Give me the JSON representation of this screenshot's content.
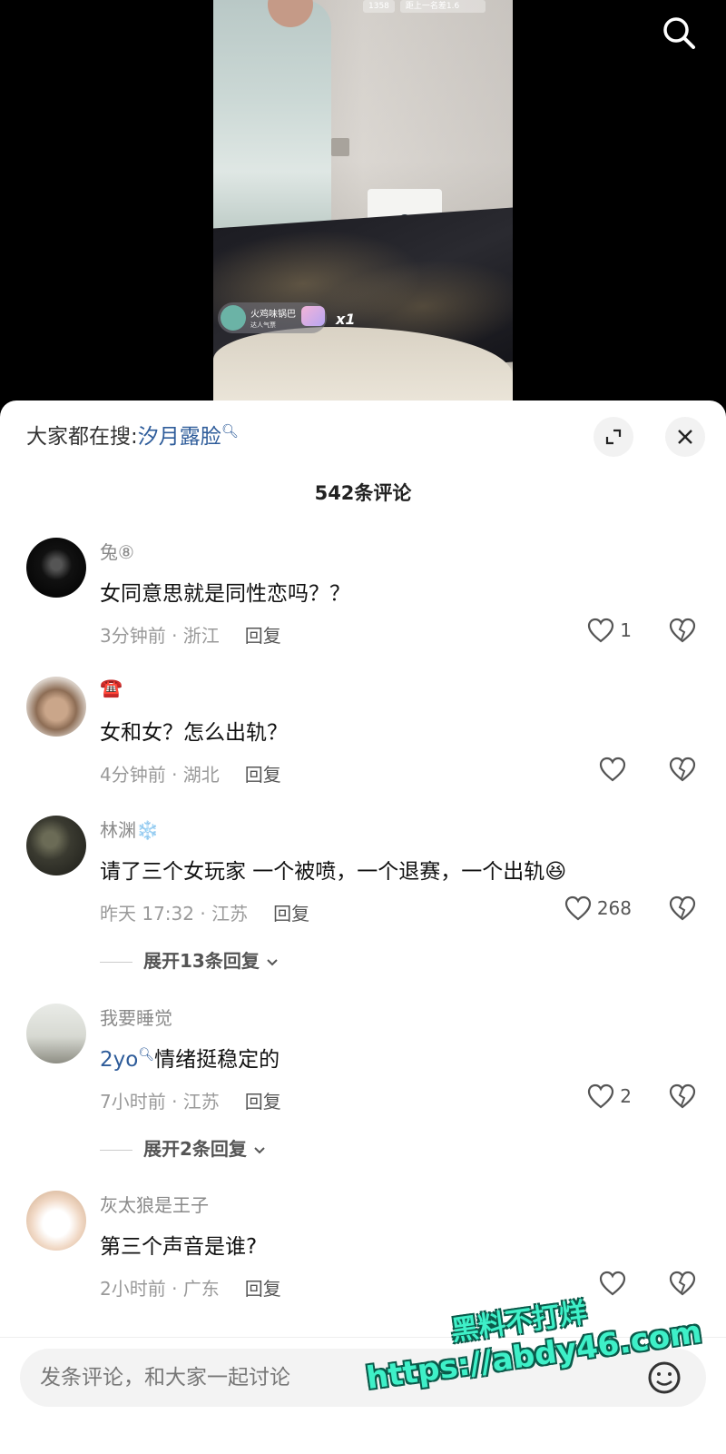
{
  "video": {
    "live_badges": [
      "1358",
      "距上一名差1.6"
    ],
    "gift": {
      "user": "火鸡味锅巴",
      "sub": "达人气票",
      "count": "x1"
    }
  },
  "header": {
    "trending_label": "大家都在搜:",
    "trending_term": "汐月露脸",
    "comment_count": "542条评论"
  },
  "comments": [
    {
      "user": "兔⑧",
      "text": "女同意思就是同性恋吗？？",
      "time": "3分钟前 · 浙江",
      "reply": "回复",
      "likes": "1"
    },
    {
      "user": "☎️",
      "text": "女和女？怎么出轨？",
      "time": "4分钟前 · 湖北",
      "reply": "回复",
      "likes": ""
    },
    {
      "user": "林渊❄️",
      "text": "请了三个女玩家 一个被喷，一个退赛，一个出轨😆",
      "time": "昨天 17:32 · 江苏",
      "reply": "回复",
      "likes": "268",
      "expand": "展开13条回复"
    },
    {
      "user": "我要睡觉",
      "link": "2yo",
      "text": "情绪挺稳定的",
      "time": "7小时前 · 江苏",
      "reply": "回复",
      "likes": "2",
      "expand": "展开2条回复"
    },
    {
      "user": "灰太狼是王子",
      "text": "第三个声音是谁?",
      "time": "2小时前 · 广东",
      "reply": "回复",
      "likes": ""
    }
  ],
  "input": {
    "placeholder": "发条评论，和大家一起讨论"
  },
  "watermark": {
    "line1": "黑料不打烊",
    "line2": "https://abdy46.com"
  }
}
